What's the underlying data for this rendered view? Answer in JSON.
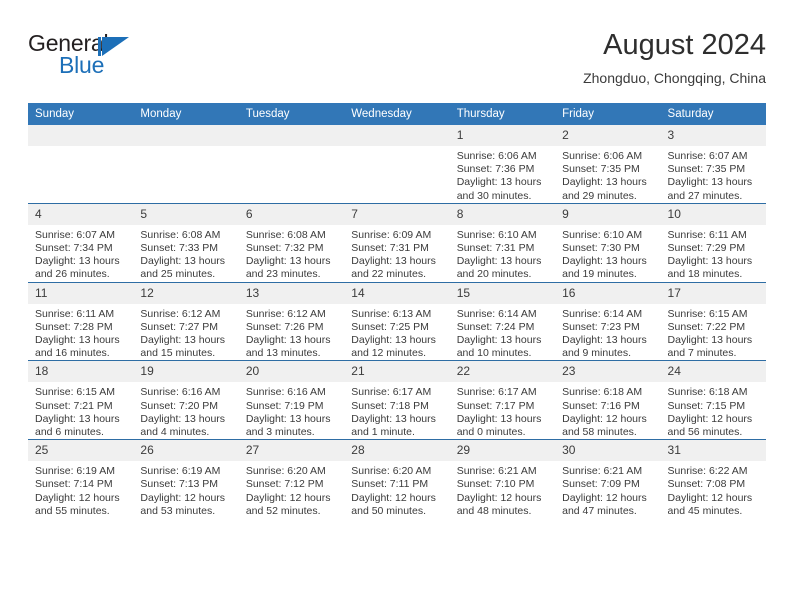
{
  "brand": {
    "name_part1": "General",
    "name_part2": "Blue",
    "flag_icon": "blue-triangle-flag-icon"
  },
  "header": {
    "title": "August 2024",
    "subtitle": "Zhongduo, Chongqing, China"
  },
  "colors": {
    "header_blue": "#3277b7",
    "row_divider_blue": "#2e6da4",
    "daynum_band": "#f0f0f0",
    "brand_blue": "#1c6fb8",
    "text": "#3b3b3b"
  },
  "weekday_headers": [
    "Sunday",
    "Monday",
    "Tuesday",
    "Wednesday",
    "Thursday",
    "Friday",
    "Saturday"
  ],
  "weeks": [
    [
      {
        "day": "",
        "blank": true,
        "sunrise": "",
        "sunset": "",
        "daylight1": "",
        "daylight2": ""
      },
      {
        "day": "",
        "blank": true,
        "sunrise": "",
        "sunset": "",
        "daylight1": "",
        "daylight2": ""
      },
      {
        "day": "",
        "blank": true,
        "sunrise": "",
        "sunset": "",
        "daylight1": "",
        "daylight2": ""
      },
      {
        "day": "",
        "blank": true,
        "sunrise": "",
        "sunset": "",
        "daylight1": "",
        "daylight2": ""
      },
      {
        "day": "1",
        "blank": false,
        "sunrise": "Sunrise: 6:06 AM",
        "sunset": "Sunset: 7:36 PM",
        "daylight1": "Daylight: 13 hours",
        "daylight2": "and 30 minutes."
      },
      {
        "day": "2",
        "blank": false,
        "sunrise": "Sunrise: 6:06 AM",
        "sunset": "Sunset: 7:35 PM",
        "daylight1": "Daylight: 13 hours",
        "daylight2": "and 29 minutes."
      },
      {
        "day": "3",
        "blank": false,
        "sunrise": "Sunrise: 6:07 AM",
        "sunset": "Sunset: 7:35 PM",
        "daylight1": "Daylight: 13 hours",
        "daylight2": "and 27 minutes."
      }
    ],
    [
      {
        "day": "4",
        "blank": false,
        "sunrise": "Sunrise: 6:07 AM",
        "sunset": "Sunset: 7:34 PM",
        "daylight1": "Daylight: 13 hours",
        "daylight2": "and 26 minutes."
      },
      {
        "day": "5",
        "blank": false,
        "sunrise": "Sunrise: 6:08 AM",
        "sunset": "Sunset: 7:33 PM",
        "daylight1": "Daylight: 13 hours",
        "daylight2": "and 25 minutes."
      },
      {
        "day": "6",
        "blank": false,
        "sunrise": "Sunrise: 6:08 AM",
        "sunset": "Sunset: 7:32 PM",
        "daylight1": "Daylight: 13 hours",
        "daylight2": "and 23 minutes."
      },
      {
        "day": "7",
        "blank": false,
        "sunrise": "Sunrise: 6:09 AM",
        "sunset": "Sunset: 7:31 PM",
        "daylight1": "Daylight: 13 hours",
        "daylight2": "and 22 minutes."
      },
      {
        "day": "8",
        "blank": false,
        "sunrise": "Sunrise: 6:10 AM",
        "sunset": "Sunset: 7:31 PM",
        "daylight1": "Daylight: 13 hours",
        "daylight2": "and 20 minutes."
      },
      {
        "day": "9",
        "blank": false,
        "sunrise": "Sunrise: 6:10 AM",
        "sunset": "Sunset: 7:30 PM",
        "daylight1": "Daylight: 13 hours",
        "daylight2": "and 19 minutes."
      },
      {
        "day": "10",
        "blank": false,
        "sunrise": "Sunrise: 6:11 AM",
        "sunset": "Sunset: 7:29 PM",
        "daylight1": "Daylight: 13 hours",
        "daylight2": "and 18 minutes."
      }
    ],
    [
      {
        "day": "11",
        "blank": false,
        "sunrise": "Sunrise: 6:11 AM",
        "sunset": "Sunset: 7:28 PM",
        "daylight1": "Daylight: 13 hours",
        "daylight2": "and 16 minutes."
      },
      {
        "day": "12",
        "blank": false,
        "sunrise": "Sunrise: 6:12 AM",
        "sunset": "Sunset: 7:27 PM",
        "daylight1": "Daylight: 13 hours",
        "daylight2": "and 15 minutes."
      },
      {
        "day": "13",
        "blank": false,
        "sunrise": "Sunrise: 6:12 AM",
        "sunset": "Sunset: 7:26 PM",
        "daylight1": "Daylight: 13 hours",
        "daylight2": "and 13 minutes."
      },
      {
        "day": "14",
        "blank": false,
        "sunrise": "Sunrise: 6:13 AM",
        "sunset": "Sunset: 7:25 PM",
        "daylight1": "Daylight: 13 hours",
        "daylight2": "and 12 minutes."
      },
      {
        "day": "15",
        "blank": false,
        "sunrise": "Sunrise: 6:14 AM",
        "sunset": "Sunset: 7:24 PM",
        "daylight1": "Daylight: 13 hours",
        "daylight2": "and 10 minutes."
      },
      {
        "day": "16",
        "blank": false,
        "sunrise": "Sunrise: 6:14 AM",
        "sunset": "Sunset: 7:23 PM",
        "daylight1": "Daylight: 13 hours",
        "daylight2": "and 9 minutes."
      },
      {
        "day": "17",
        "blank": false,
        "sunrise": "Sunrise: 6:15 AM",
        "sunset": "Sunset: 7:22 PM",
        "daylight1": "Daylight: 13 hours",
        "daylight2": "and 7 minutes."
      }
    ],
    [
      {
        "day": "18",
        "blank": false,
        "sunrise": "Sunrise: 6:15 AM",
        "sunset": "Sunset: 7:21 PM",
        "daylight1": "Daylight: 13 hours",
        "daylight2": "and 6 minutes."
      },
      {
        "day": "19",
        "blank": false,
        "sunrise": "Sunrise: 6:16 AM",
        "sunset": "Sunset: 7:20 PM",
        "daylight1": "Daylight: 13 hours",
        "daylight2": "and 4 minutes."
      },
      {
        "day": "20",
        "blank": false,
        "sunrise": "Sunrise: 6:16 AM",
        "sunset": "Sunset: 7:19 PM",
        "daylight1": "Daylight: 13 hours",
        "daylight2": "and 3 minutes."
      },
      {
        "day": "21",
        "blank": false,
        "sunrise": "Sunrise: 6:17 AM",
        "sunset": "Sunset: 7:18 PM",
        "daylight1": "Daylight: 13 hours",
        "daylight2": "and 1 minute."
      },
      {
        "day": "22",
        "blank": false,
        "sunrise": "Sunrise: 6:17 AM",
        "sunset": "Sunset: 7:17 PM",
        "daylight1": "Daylight: 13 hours",
        "daylight2": "and 0 minutes."
      },
      {
        "day": "23",
        "blank": false,
        "sunrise": "Sunrise: 6:18 AM",
        "sunset": "Sunset: 7:16 PM",
        "daylight1": "Daylight: 12 hours",
        "daylight2": "and 58 minutes."
      },
      {
        "day": "24",
        "blank": false,
        "sunrise": "Sunrise: 6:18 AM",
        "sunset": "Sunset: 7:15 PM",
        "daylight1": "Daylight: 12 hours",
        "daylight2": "and 56 minutes."
      }
    ],
    [
      {
        "day": "25",
        "blank": false,
        "sunrise": "Sunrise: 6:19 AM",
        "sunset": "Sunset: 7:14 PM",
        "daylight1": "Daylight: 12 hours",
        "daylight2": "and 55 minutes."
      },
      {
        "day": "26",
        "blank": false,
        "sunrise": "Sunrise: 6:19 AM",
        "sunset": "Sunset: 7:13 PM",
        "daylight1": "Daylight: 12 hours",
        "daylight2": "and 53 minutes."
      },
      {
        "day": "27",
        "blank": false,
        "sunrise": "Sunrise: 6:20 AM",
        "sunset": "Sunset: 7:12 PM",
        "daylight1": "Daylight: 12 hours",
        "daylight2": "and 52 minutes."
      },
      {
        "day": "28",
        "blank": false,
        "sunrise": "Sunrise: 6:20 AM",
        "sunset": "Sunset: 7:11 PM",
        "daylight1": "Daylight: 12 hours",
        "daylight2": "and 50 minutes."
      },
      {
        "day": "29",
        "blank": false,
        "sunrise": "Sunrise: 6:21 AM",
        "sunset": "Sunset: 7:10 PM",
        "daylight1": "Daylight: 12 hours",
        "daylight2": "and 48 minutes."
      },
      {
        "day": "30",
        "blank": false,
        "sunrise": "Sunrise: 6:21 AM",
        "sunset": "Sunset: 7:09 PM",
        "daylight1": "Daylight: 12 hours",
        "daylight2": "and 47 minutes."
      },
      {
        "day": "31",
        "blank": false,
        "sunrise": "Sunrise: 6:22 AM",
        "sunset": "Sunset: 7:08 PM",
        "daylight1": "Daylight: 12 hours",
        "daylight2": "and 45 minutes."
      }
    ]
  ]
}
